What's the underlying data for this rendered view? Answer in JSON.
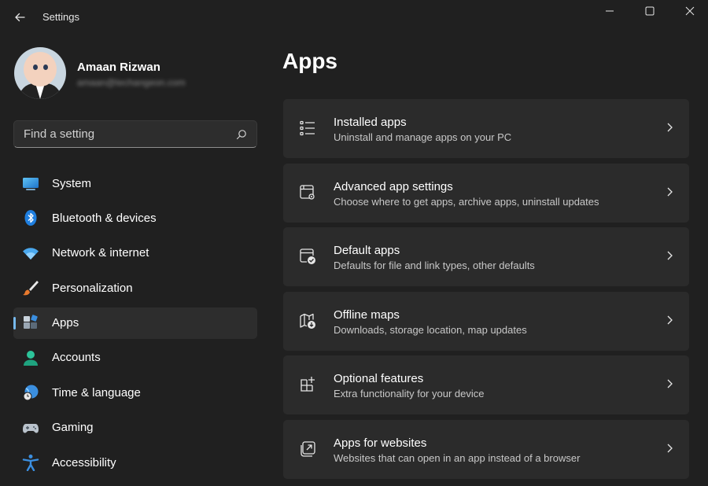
{
  "window": {
    "title": "Settings",
    "controls": [
      "minimize-icon",
      "maximize-icon",
      "close-icon"
    ]
  },
  "profile": {
    "name": "Amaan Rizwan",
    "email": "amaan@techangeon.com"
  },
  "search": {
    "placeholder": "Find a setting",
    "value": ""
  },
  "nav": {
    "items": [
      {
        "label": "System",
        "icon": "system-icon"
      },
      {
        "label": "Bluetooth & devices",
        "icon": "bluetooth-icon"
      },
      {
        "label": "Network & internet",
        "icon": "wifi-icon"
      },
      {
        "label": "Personalization",
        "icon": "brush-icon"
      },
      {
        "label": "Apps",
        "icon": "apps-icon",
        "active": true
      },
      {
        "label": "Accounts",
        "icon": "person-icon"
      },
      {
        "label": "Time & language",
        "icon": "globe-clock-icon"
      },
      {
        "label": "Gaming",
        "icon": "gamepad-icon"
      },
      {
        "label": "Accessibility",
        "icon": "accessibility-icon"
      }
    ]
  },
  "main": {
    "title": "Apps",
    "cards": [
      {
        "title": "Installed apps",
        "subtitle": "Uninstall and manage apps on your PC",
        "icon": "list-icon"
      },
      {
        "title": "Advanced app settings",
        "subtitle": "Choose where to get apps, archive apps, uninstall updates",
        "icon": "app-gear-icon"
      },
      {
        "title": "Default apps",
        "subtitle": "Defaults for file and link types, other defaults",
        "icon": "app-check-icon"
      },
      {
        "title": "Offline maps",
        "subtitle": "Downloads, storage location, map updates",
        "icon": "map-download-icon"
      },
      {
        "title": "Optional features",
        "subtitle": "Extra functionality for your device",
        "icon": "grid-add-icon"
      },
      {
        "title": "Apps for websites",
        "subtitle": "Websites that can open in an app instead of a browser",
        "icon": "open-external-icon"
      }
    ]
  },
  "colors": {
    "background": "#202020",
    "card": "#2b2b2b",
    "accent": "#76b9ed"
  }
}
